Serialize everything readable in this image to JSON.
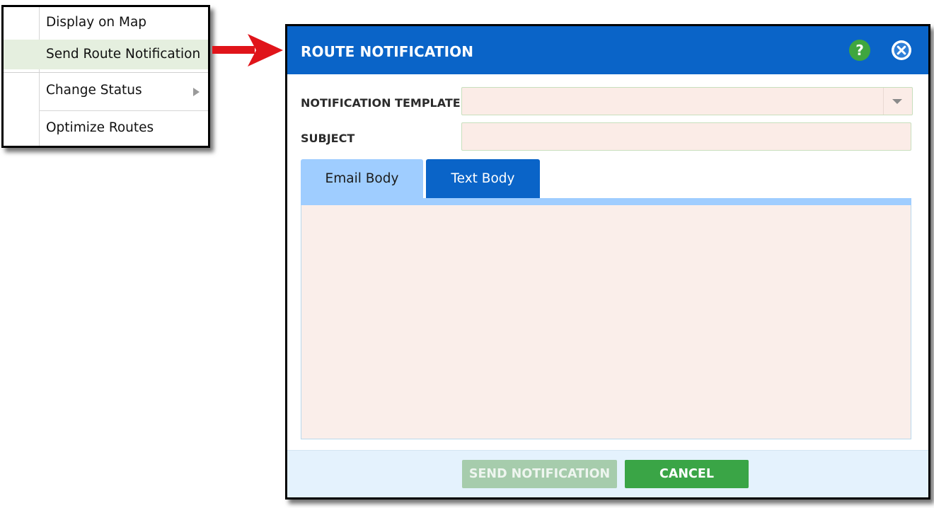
{
  "context_menu": {
    "items": [
      {
        "label": "Display on Map"
      },
      {
        "label": "Send Route Notification",
        "highlighted": true
      },
      {
        "label": "Change Status",
        "has_submenu": true
      },
      {
        "label": "Optimize Routes"
      }
    ]
  },
  "callout": {
    "icon": "arrow-right-icon",
    "color": "#e0141a"
  },
  "dialog": {
    "title": "ROUTE NOTIFICATION",
    "help_label": "?",
    "help_icon": "help-icon",
    "close_icon": "close-icon",
    "colors": {
      "header": "#0a64c8",
      "help": "#3fa63f",
      "cancel": "#3aa546"
    },
    "form": {
      "template_label": "NOTIFICATION TEMPLATE",
      "template_value": "",
      "subject_label": "SUBJECT",
      "subject_value": "",
      "subject_placeholder": ""
    },
    "tabs": [
      {
        "label": "Email Body",
        "active": true
      },
      {
        "label": "Text Body",
        "active": false
      }
    ],
    "body_value": "",
    "buttons": {
      "send_label": "SEND NOTIFICATION",
      "send_disabled": true,
      "cancel_label": "CANCEL"
    }
  }
}
